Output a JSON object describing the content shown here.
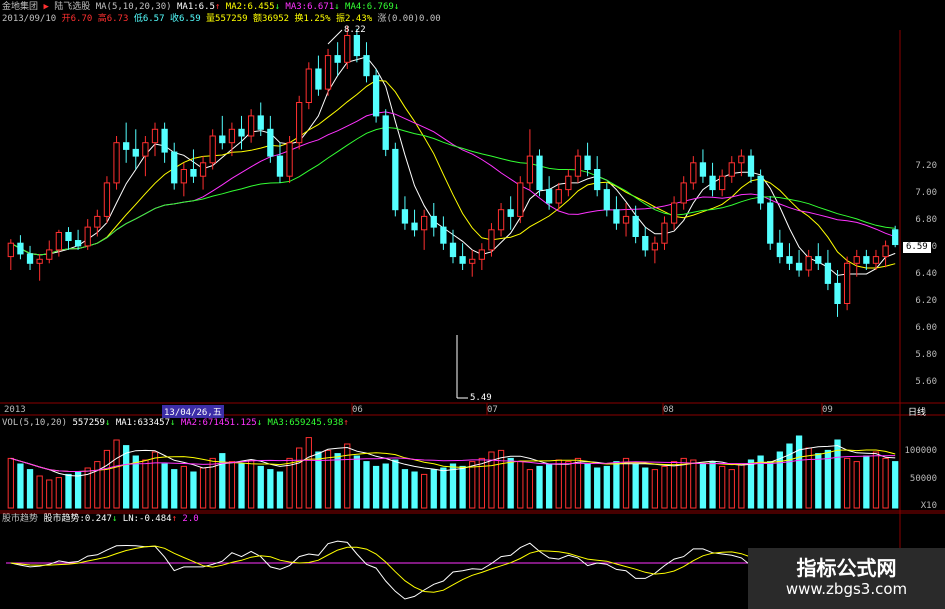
{
  "header": {
    "name": "金地集团",
    "marker": "▶",
    "board": "陆飞选股",
    "ma_label": "MA(5,10,20,30)",
    "ma1": "MA1:6.5",
    "ma2": "MA2:6.455",
    "ma3": "MA3:6.671",
    "ma4": "MA4:6.769",
    "date": "2013/09/10",
    "open": "开6.70",
    "high": "高6.73",
    "low": "低6.57",
    "close": "收6.59",
    "volume": "量557259",
    "amount": "额36952",
    "turnover": "换1.25%",
    "amplitude": "振2.43%",
    "change": "涨(0.00)0.00"
  },
  "price_axis": {
    "ticks": [
      "7.20",
      "7.00",
      "6.80",
      "6.60",
      "6.40",
      "6.20",
      "6.00",
      "5.80",
      "5.60"
    ],
    "current": "6.59",
    "high_annot": "8.22",
    "low_annot": "5.49"
  },
  "date_axis": {
    "year": "2013",
    "cursor": "13/04/26,五",
    "months": [
      "06",
      "07",
      "08",
      "09"
    ],
    "period": "日线"
  },
  "volume_panel": {
    "label": "VOL(5,10,20)",
    "v": "557259",
    "ma1": "MA1:633457",
    "ma2": "MA2:671451.125",
    "ma3": "MA3:659245.938",
    "ticks": [
      "100000",
      "50000",
      "X10"
    ]
  },
  "indicator_panel": {
    "name": "股市趋势",
    "label": "股市趋势:0.247",
    "ln": "LN:-0.484",
    "val": "2.0"
  },
  "watermark": {
    "title": "指标公式网",
    "url": "www.zbgs3.com"
  },
  "colors": {
    "up": "#ff3030",
    "down": "#54ffff",
    "ma5": "#ffffff",
    "ma10": "#ffff00",
    "ma20": "#ff33ff",
    "ma30": "#33ff33",
    "grid": "#8b0000"
  },
  "chart_data": {
    "type": "candlestick",
    "candles": [
      [
        6.5,
        6.63,
        6.4,
        6.6
      ],
      [
        6.6,
        6.66,
        6.48,
        6.52
      ],
      [
        6.52,
        6.58,
        6.4,
        6.45
      ],
      [
        6.45,
        6.52,
        6.32,
        6.48
      ],
      [
        6.48,
        6.62,
        6.45,
        6.55
      ],
      [
        6.55,
        6.7,
        6.5,
        6.68
      ],
      [
        6.68,
        6.72,
        6.55,
        6.62
      ],
      [
        6.62,
        6.7,
        6.55,
        6.58
      ],
      [
        6.58,
        6.78,
        6.55,
        6.72
      ],
      [
        6.72,
        6.85,
        6.65,
        6.8
      ],
      [
        6.8,
        7.1,
        6.75,
        7.05
      ],
      [
        7.05,
        7.4,
        7.0,
        7.35
      ],
      [
        7.35,
        7.5,
        7.2,
        7.3
      ],
      [
        7.3,
        7.45,
        7.15,
        7.25
      ],
      [
        7.25,
        7.4,
        7.1,
        7.35
      ],
      [
        7.35,
        7.5,
        7.25,
        7.45
      ],
      [
        7.45,
        7.5,
        7.2,
        7.28
      ],
      [
        7.28,
        7.35,
        7.0,
        7.05
      ],
      [
        7.05,
        7.2,
        6.95,
        7.15
      ],
      [
        7.15,
        7.3,
        7.05,
        7.1
      ],
      [
        7.1,
        7.25,
        7.0,
        7.2
      ],
      [
        7.2,
        7.45,
        7.15,
        7.4
      ],
      [
        7.4,
        7.55,
        7.3,
        7.35
      ],
      [
        7.35,
        7.5,
        7.25,
        7.45
      ],
      [
        7.45,
        7.55,
        7.3,
        7.4
      ],
      [
        7.4,
        7.6,
        7.35,
        7.55
      ],
      [
        7.55,
        7.65,
        7.4,
        7.45
      ],
      [
        7.45,
        7.55,
        7.2,
        7.25
      ],
      [
        7.25,
        7.35,
        7.05,
        7.1
      ],
      [
        7.1,
        7.4,
        7.05,
        7.35
      ],
      [
        7.35,
        7.7,
        7.3,
        7.65
      ],
      [
        7.65,
        7.95,
        7.6,
        7.9
      ],
      [
        7.9,
        8.0,
        7.7,
        7.75
      ],
      [
        7.75,
        8.05,
        7.7,
        8.0
      ],
      [
        8.0,
        8.1,
        7.85,
        7.95
      ],
      [
        7.95,
        8.22,
        7.9,
        8.15
      ],
      [
        8.15,
        8.2,
        7.95,
        8.0
      ],
      [
        8.0,
        8.1,
        7.8,
        7.85
      ],
      [
        7.85,
        7.9,
        7.5,
        7.55
      ],
      [
        7.55,
        7.6,
        7.25,
        7.3
      ],
      [
        7.3,
        7.35,
        6.8,
        6.85
      ],
      [
        6.85,
        6.95,
        6.7,
        6.75
      ],
      [
        6.75,
        6.85,
        6.65,
        6.7
      ],
      [
        6.7,
        6.85,
        6.55,
        6.8
      ],
      [
        6.8,
        6.9,
        6.65,
        6.72
      ],
      [
        6.72,
        6.8,
        6.55,
        6.6
      ],
      [
        6.6,
        6.7,
        6.45,
        6.5
      ],
      [
        6.5,
        6.6,
        6.4,
        6.45
      ],
      [
        6.45,
        6.55,
        6.35,
        6.48
      ],
      [
        6.48,
        6.6,
        6.4,
        6.55
      ],
      [
        6.55,
        6.75,
        6.5,
        6.7
      ],
      [
        6.7,
        6.9,
        6.65,
        6.85
      ],
      [
        6.85,
        6.95,
        6.7,
        6.8
      ],
      [
        6.8,
        7.1,
        6.75,
        7.05
      ],
      [
        7.05,
        7.45,
        7.0,
        7.25
      ],
      [
        7.25,
        7.3,
        6.95,
        7.0
      ],
      [
        7.0,
        7.1,
        6.85,
        6.9
      ],
      [
        6.9,
        7.05,
        6.85,
        7.0
      ],
      [
        7.0,
        7.15,
        6.95,
        7.1
      ],
      [
        7.1,
        7.3,
        7.05,
        7.25
      ],
      [
        7.25,
        7.35,
        7.1,
        7.15
      ],
      [
        7.15,
        7.25,
        6.95,
        7.0
      ],
      [
        7.0,
        7.05,
        6.8,
        6.85
      ],
      [
        6.85,
        6.95,
        6.7,
        6.75
      ],
      [
        6.75,
        6.9,
        6.65,
        6.8
      ],
      [
        6.8,
        6.88,
        6.6,
        6.65
      ],
      [
        6.65,
        6.72,
        6.5,
        6.55
      ],
      [
        6.55,
        6.65,
        6.45,
        6.6
      ],
      [
        6.6,
        6.8,
        6.55,
        6.75
      ],
      [
        6.75,
        6.95,
        6.7,
        6.9
      ],
      [
        6.9,
        7.1,
        6.85,
        7.05
      ],
      [
        7.05,
        7.25,
        7.0,
        7.2
      ],
      [
        7.2,
        7.3,
        7.05,
        7.1
      ],
      [
        7.1,
        7.2,
        6.95,
        7.0
      ],
      [
        7.0,
        7.15,
        6.95,
        7.1
      ],
      [
        7.1,
        7.25,
        7.05,
        7.2
      ],
      [
        7.2,
        7.3,
        7.1,
        7.25
      ],
      [
        7.25,
        7.3,
        7.05,
        7.1
      ],
      [
        7.1,
        7.15,
        6.85,
        6.9
      ],
      [
        6.9,
        6.95,
        6.55,
        6.6
      ],
      [
        6.6,
        6.7,
        6.45,
        6.5
      ],
      [
        6.5,
        6.6,
        6.4,
        6.45
      ],
      [
        6.45,
        6.55,
        6.35,
        6.4
      ],
      [
        6.4,
        6.55,
        6.35,
        6.5
      ],
      [
        6.5,
        6.6,
        6.4,
        6.45
      ],
      [
        6.45,
        6.55,
        6.25,
        6.3
      ],
      [
        6.3,
        6.4,
        6.05,
        6.15
      ],
      [
        6.15,
        6.5,
        6.1,
        6.45
      ],
      [
        6.45,
        6.55,
        6.35,
        6.5
      ],
      [
        6.5,
        6.55,
        6.4,
        6.45
      ],
      [
        6.45,
        6.55,
        6.4,
        6.5
      ],
      [
        6.5,
        6.62,
        6.42,
        6.58
      ],
      [
        6.7,
        6.73,
        6.57,
        6.59
      ]
    ],
    "volume": [
      62,
      55,
      48,
      40,
      35,
      38,
      42,
      45,
      50,
      58,
      72,
      85,
      78,
      65,
      60,
      70,
      55,
      48,
      52,
      45,
      50,
      62,
      68,
      58,
      55,
      60,
      52,
      48,
      45,
      62,
      75,
      88,
      70,
      72,
      68,
      80,
      65,
      58,
      52,
      55,
      60,
      48,
      45,
      42,
      48,
      50,
      55,
      52,
      58,
      62,
      70,
      72,
      62,
      58,
      48,
      52,
      55,
      60,
      58,
      62,
      55,
      50,
      52,
      58,
      62,
      55,
      50,
      48,
      52,
      58,
      62,
      60,
      55,
      58,
      52,
      48,
      55,
      60,
      65,
      58,
      70,
      80,
      90,
      75,
      68,
      72,
      85,
      62,
      58,
      65,
      70,
      62,
      58
    ],
    "ylim": [
      5.49,
      8.22
    ]
  }
}
